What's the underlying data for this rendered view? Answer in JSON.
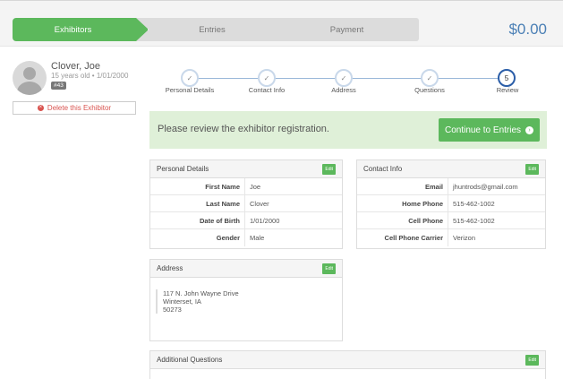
{
  "steps": {
    "exhibitors": "Exhibitors",
    "entries": "Entries",
    "payment": "Payment"
  },
  "total": "$0.00",
  "exhibitor": {
    "name": "Clover, Joe",
    "details": "15 years old • 1/01/2000",
    "badge": "#43",
    "delete_label": "Delete this Exhibitor"
  },
  "progress": [
    {
      "label": "Personal Details",
      "icon": "check"
    },
    {
      "label": "Contact Info",
      "icon": "check"
    },
    {
      "label": "Address",
      "icon": "check"
    },
    {
      "label": "Questions",
      "icon": "check"
    },
    {
      "label": "Review",
      "number": "5"
    }
  ],
  "review": {
    "message": "Please review the exhibitor registration.",
    "continue_label": "Continue to Entries"
  },
  "edit_label": "Edit",
  "personal": {
    "title": "Personal Details",
    "rows": [
      {
        "label": "First Name",
        "value": "Joe"
      },
      {
        "label": "Last Name",
        "value": "Clover"
      },
      {
        "label": "Date of Birth",
        "value": "1/01/2000"
      },
      {
        "label": "Gender",
        "value": "Male"
      }
    ]
  },
  "contact": {
    "title": "Contact Info",
    "rows": [
      {
        "label": "Email",
        "value": "jhuntrods@gmail.com"
      },
      {
        "label": "Home Phone",
        "value": "515-462-1002"
      },
      {
        "label": "Cell Phone",
        "value": "515-462-1002"
      },
      {
        "label": "Cell Phone Carrier",
        "value": "Verizon"
      }
    ]
  },
  "address": {
    "title": "Address",
    "line1": "117 N. John Wayne Drive",
    "line2": "Winterset, IA",
    "line3": "50273"
  },
  "questions": {
    "title": "Additional Questions"
  },
  "colors": {
    "green": "#5cb85c",
    "blue": "#2b5ea8",
    "banner": "#dff0d8",
    "red": "#d9534f"
  }
}
